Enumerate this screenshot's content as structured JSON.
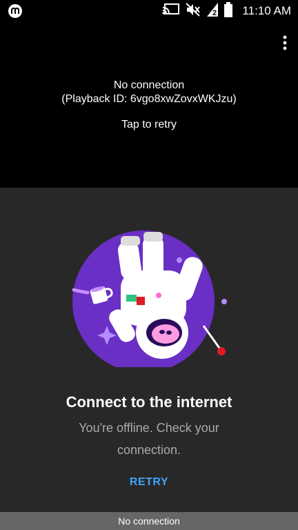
{
  "status_bar": {
    "time": "11:10 AM",
    "icons": [
      "app-badge-icon",
      "cast-icon",
      "mute-icon",
      "signal-icon",
      "battery-icon"
    ]
  },
  "player": {
    "message_line1": "No connection",
    "message_line2": "(Playback ID: 6vgo8xwZovxWKJzu)",
    "retry_text": "Tap to retry"
  },
  "offline": {
    "title": "Connect to the internet",
    "subtitle": "You're offline. Check your connection.",
    "retry_label": "RETRY"
  },
  "bottom_bar": {
    "text": "No connection"
  },
  "colors": {
    "panel_bg": "#282828",
    "accent": "#3ea6ff",
    "circle": "#6a2fc4"
  }
}
